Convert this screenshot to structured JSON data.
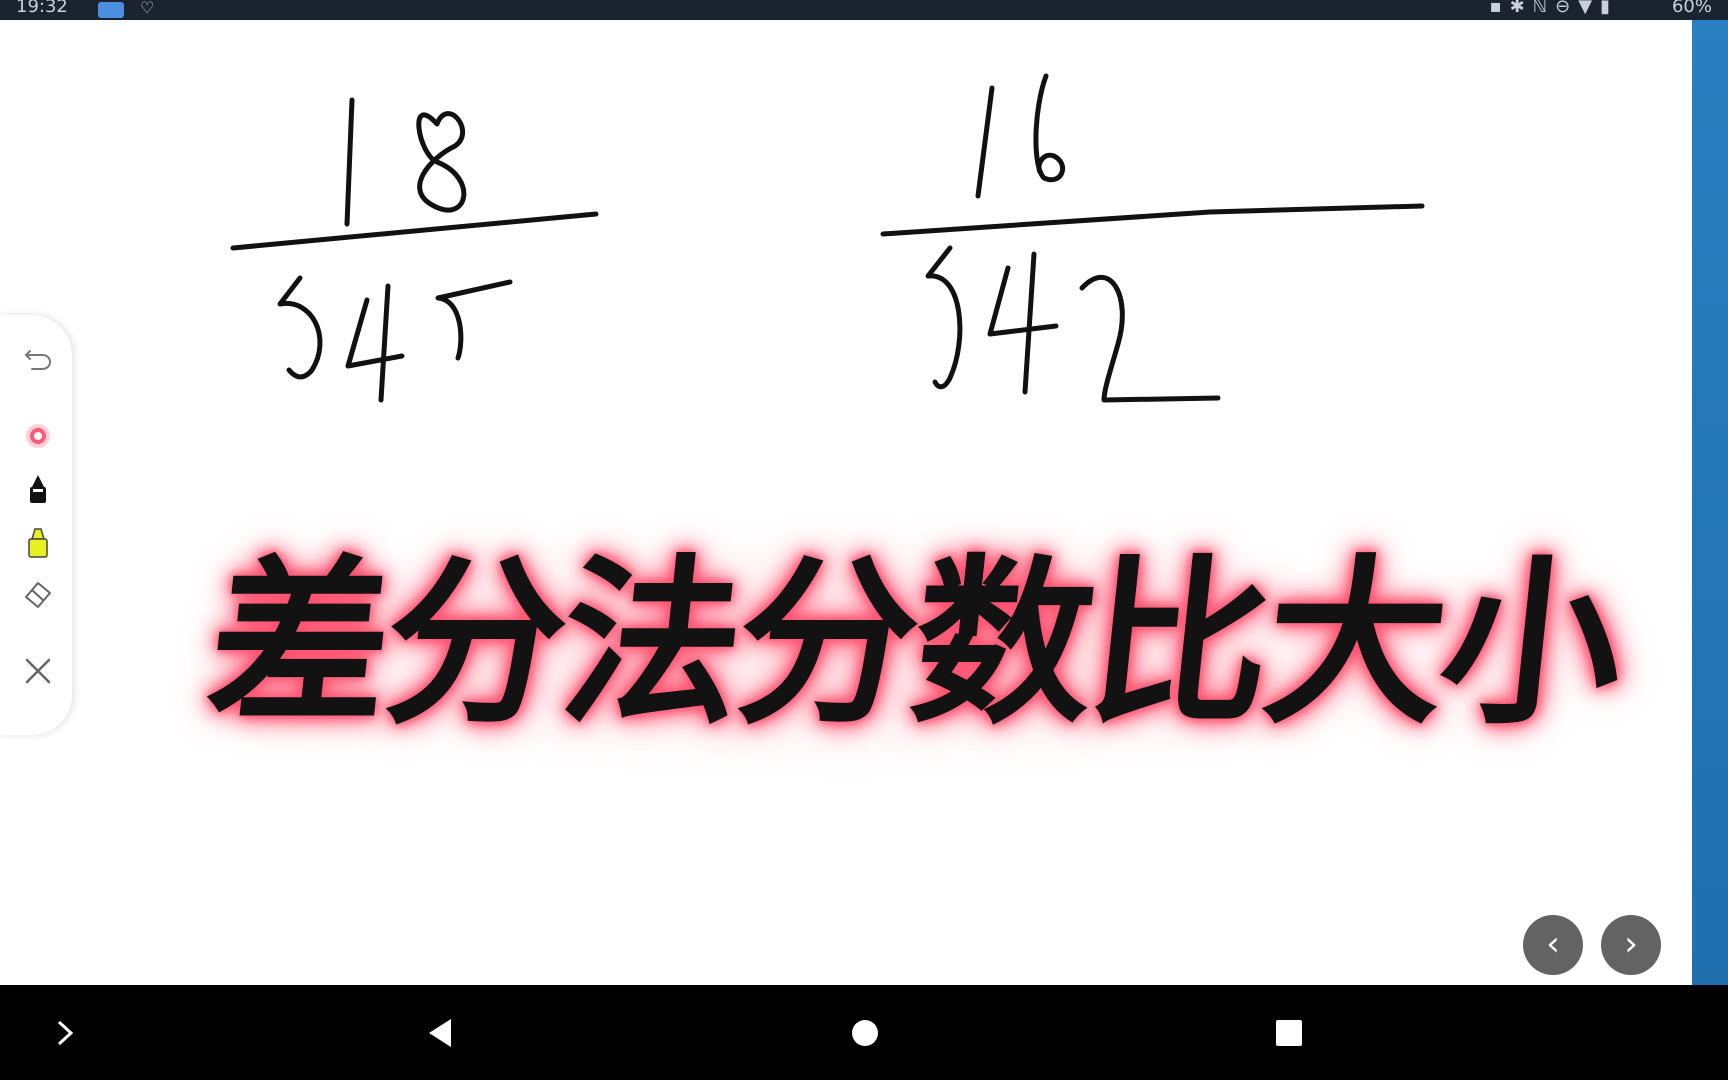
{
  "status_bar": {
    "time": "19:32",
    "battery": "60%",
    "icons": [
      "app-icon",
      "vpn-icon",
      "cast-icon",
      "bluetooth-icon",
      "nfc-icon",
      "dnd-icon",
      "wifi-icon",
      "battery-icon"
    ]
  },
  "whiteboard": {
    "fraction_1": {
      "numerator": "18",
      "denominator": "545"
    },
    "fraction_2": {
      "numerator": "16",
      "denominator": "542"
    }
  },
  "toolbar": {
    "tools": [
      "undo-icon",
      "laser-pointer-icon",
      "pen-icon",
      "highlighter-icon",
      "eraser-icon",
      "close-icon"
    ]
  },
  "banner": {
    "title": "差分法分数比大小"
  },
  "pager": {
    "prev": "‹",
    "next": "›"
  },
  "android_nav": {
    "keys": [
      "expand-icon",
      "back-icon",
      "home-icon",
      "recents-icon"
    ]
  },
  "colors": {
    "accent_pink": "#ff3c5e",
    "side_blue": "#1f6fae",
    "highlighter_yellow": "#e8f020"
  }
}
